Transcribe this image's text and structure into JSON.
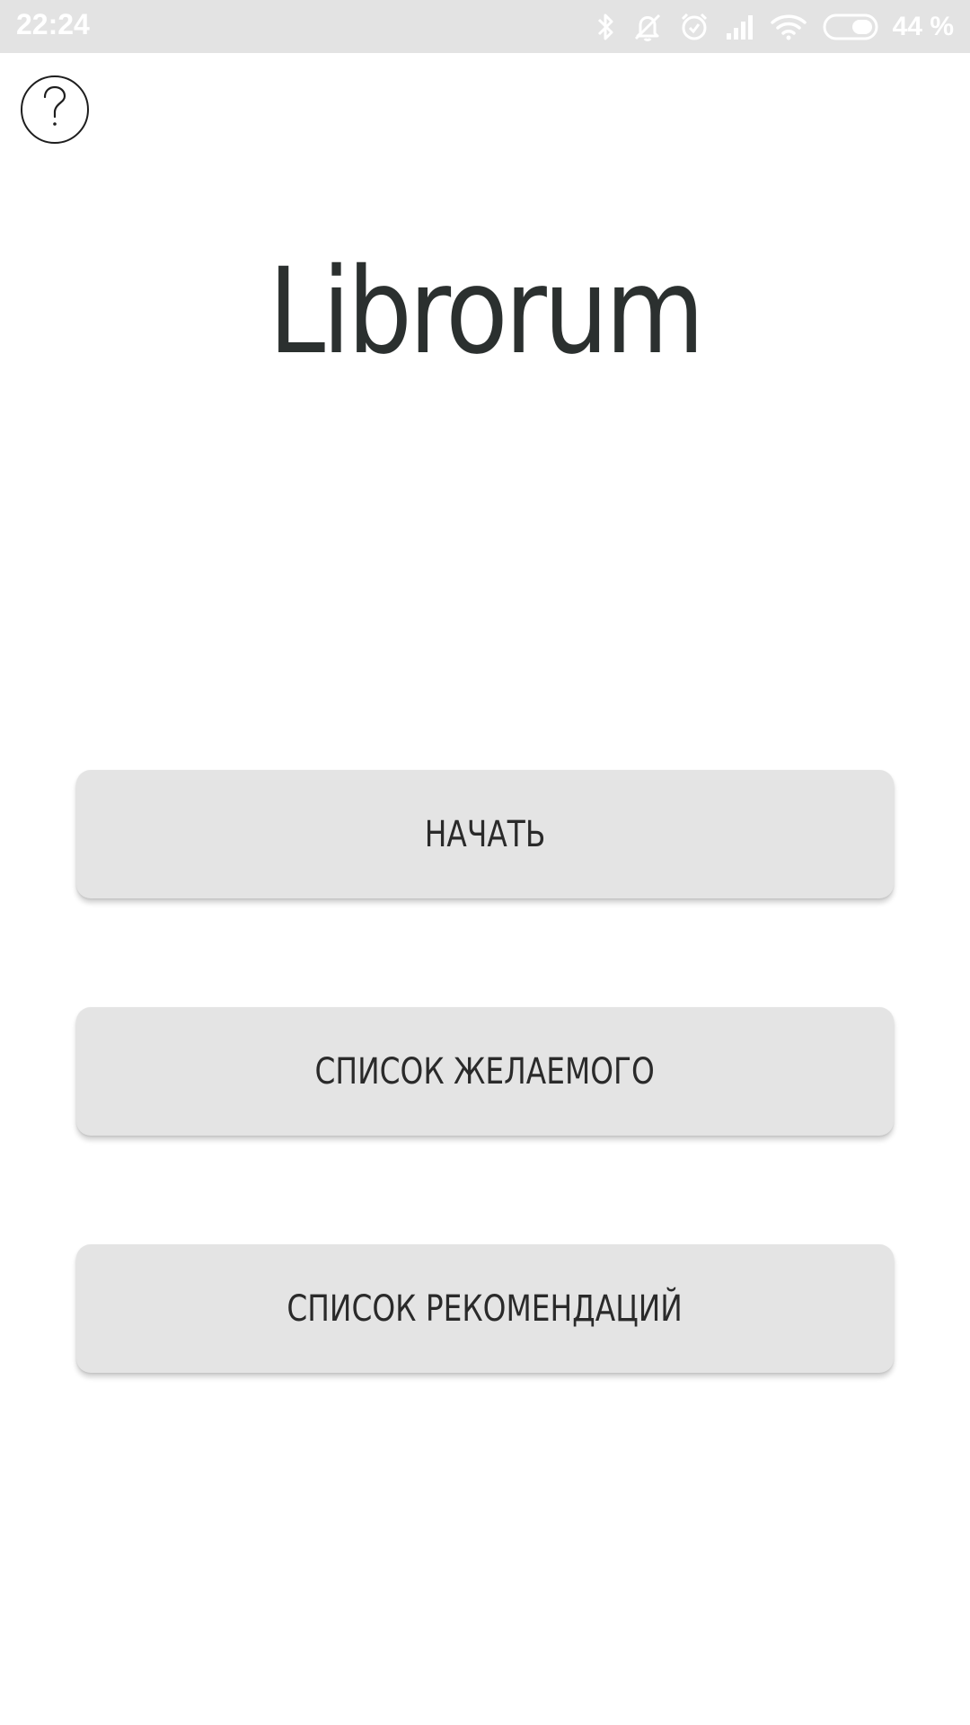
{
  "status_bar": {
    "time": "22:24",
    "battery_percent": "44 %",
    "icons": [
      "bluetooth-icon",
      "notifications-off-icon",
      "alarm-icon",
      "signal-icon",
      "wifi-icon",
      "battery-icon"
    ]
  },
  "help": {
    "icon": "question-mark-icon"
  },
  "app": {
    "title": "Librorum"
  },
  "menu": {
    "start_label": "НАЧАТЬ",
    "wishlist_label": "СПИСОК ЖЕЛАЕМОГО",
    "recommendations_label": "СПИСОК РЕКОМЕНДАЦИЙ"
  },
  "colors": {
    "status_bar_bg": "#e3e3e3",
    "button_bg": "#e4e4e4",
    "title_text": "#2b302f"
  }
}
